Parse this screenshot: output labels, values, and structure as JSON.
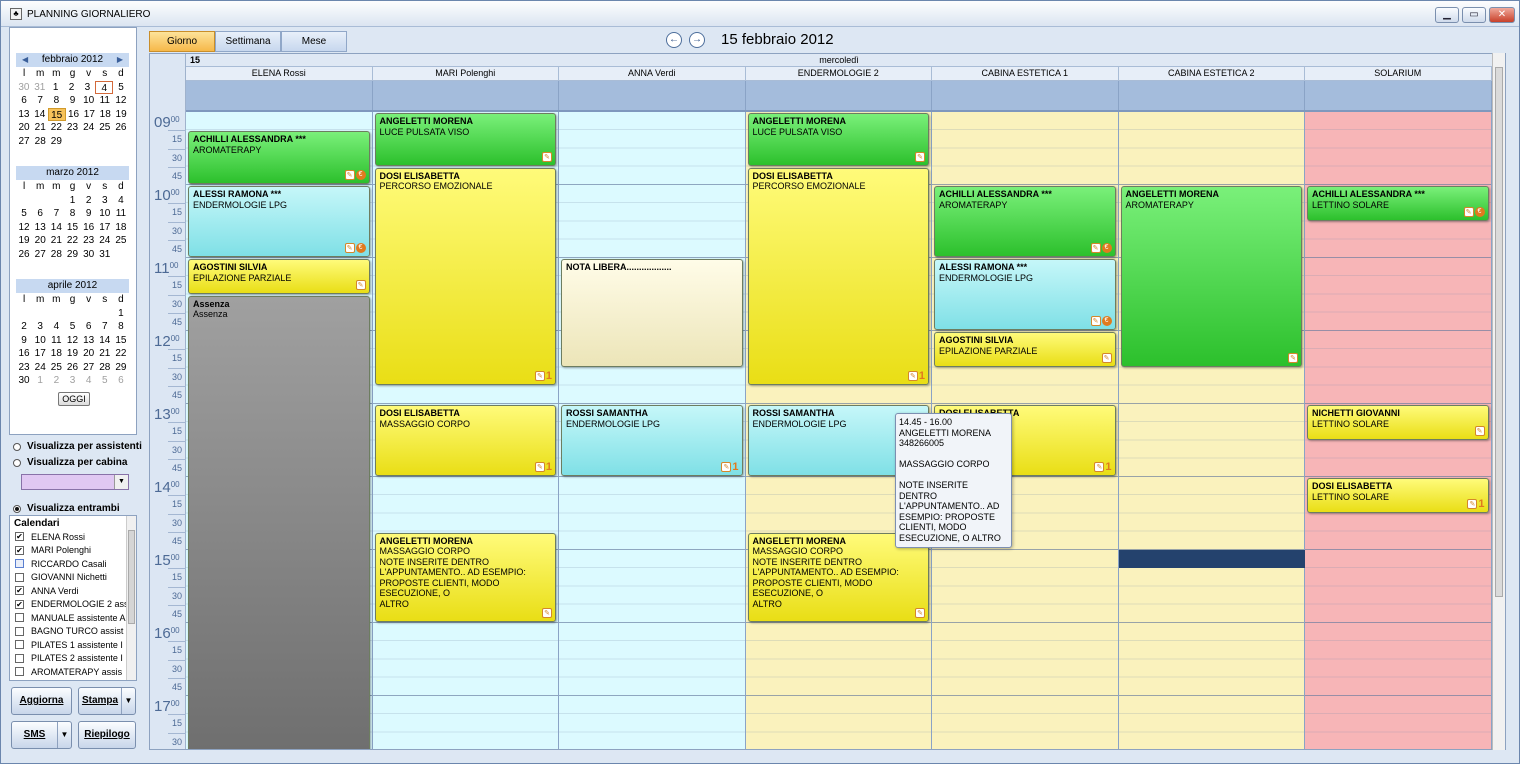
{
  "window": {
    "title": "PLANNING GIORNALIERO",
    "min": "▁",
    "max": "▭",
    "close": "✕"
  },
  "calendar": {
    "dow": [
      "l",
      "m",
      "m",
      "g",
      "v",
      "s",
      "d"
    ],
    "months": [
      {
        "label": "febbraio 2012",
        "weeks": [
          [
            "30",
            "31",
            "1",
            "2",
            "3",
            "4",
            "5"
          ],
          [
            "6",
            "7",
            "8",
            "9",
            "10",
            "11",
            "12"
          ],
          [
            "13",
            "14",
            "15",
            "16",
            "17",
            "18",
            "19"
          ],
          [
            "20",
            "21",
            "22",
            "23",
            "24",
            "25",
            "26"
          ],
          [
            "27",
            "28",
            "29",
            "",
            "",
            "",
            ""
          ]
        ]
      },
      {
        "label": "marzo 2012",
        "weeks": [
          [
            "",
            "",
            "",
            "1",
            "2",
            "3",
            "4"
          ],
          [
            "5",
            "6",
            "7",
            "8",
            "9",
            "10",
            "11"
          ],
          [
            "12",
            "13",
            "14",
            "15",
            "16",
            "17",
            "18"
          ],
          [
            "19",
            "20",
            "21",
            "22",
            "23",
            "24",
            "25"
          ],
          [
            "26",
            "27",
            "28",
            "29",
            "30",
            "31",
            ""
          ]
        ]
      },
      {
        "label": "aprile 2012",
        "weeks": [
          [
            "",
            "",
            "",
            "",
            "",
            "",
            "1"
          ],
          [
            "2",
            "3",
            "4",
            "5",
            "6",
            "7",
            "8"
          ],
          [
            "9",
            "10",
            "11",
            "12",
            "13",
            "14",
            "15"
          ],
          [
            "16",
            "17",
            "18",
            "19",
            "20",
            "21",
            "22"
          ],
          [
            "23",
            "24",
            "25",
            "26",
            "27",
            "28",
            "29"
          ],
          [
            "30",
            "1",
            "2",
            "3",
            "4",
            "5",
            "6"
          ]
        ]
      }
    ],
    "today_label": "OGGI"
  },
  "view_options": {
    "per_assistenti": "Visualizza per assistenti",
    "per_cabina": "Visualizza per cabina",
    "entrambi": "Visualizza entrambi"
  },
  "calendars": {
    "header": "Calendari",
    "items": [
      {
        "label": "ELENA Rossi",
        "checked": true
      },
      {
        "label": "MARI Polenghi",
        "checked": true
      },
      {
        "label": "RICCARDO Casali",
        "checked": false
      },
      {
        "label": "GIOVANNI Nichetti",
        "checked": false
      },
      {
        "label": "ANNA Verdi",
        "checked": true
      },
      {
        "label": "ENDERMOLOGIE 2 ass",
        "checked": true
      },
      {
        "label": "MANUALE assistente A",
        "checked": false
      },
      {
        "label": "BAGNO TURCO assist",
        "checked": false
      },
      {
        "label": "PILATES 1 assistente I",
        "checked": false
      },
      {
        "label": "PILATES 2 assistente I",
        "checked": false
      },
      {
        "label": "AROMATERAPY assis",
        "checked": false
      }
    ]
  },
  "buttons": {
    "aggiorna": "Aggiorna",
    "stampa": "Stampa",
    "sms": "SMS",
    "riepilogo": "Riepilogo",
    "dropdown": "▼"
  },
  "tabs": {
    "giorno": "Giorno",
    "settimana": "Settimana",
    "mese": "Mese"
  },
  "header": {
    "date": "15 febbraio 2012",
    "prev": "←",
    "next": "→",
    "day_number": "15",
    "day_name": "mercoledì"
  },
  "columns": [
    "ELENA Rossi",
    "MARI Polenghi",
    "ANNA Verdi",
    "ENDERMOLOGIE 2",
    "CABINA ESTETICA 1",
    "CABINA ESTETICA 2",
    "SOLARIUM"
  ],
  "hours": [
    "09",
    "10",
    "11",
    "12",
    "13",
    "14",
    "15",
    "16",
    "17"
  ],
  "quarters": [
    "15",
    "30",
    "45"
  ],
  "hour_suffix": "00",
  "tooltip": [
    "14.45 - 16.00",
    "ANGELETTI MORENA",
    "348266005",
    "",
    "MASSAGGIO CORPO",
    "",
    "NOTE INSERITE DENTRO",
    "L'APPUNTAMENTO.. AD",
    "ESEMPIO: PROPOSTE",
    "CLIENTI, MODO",
    "ESECUZIONE, O ALTRO"
  ],
  "icon_one": "1",
  "events": [
    {
      "col": 0,
      "start": 1,
      "end": 4,
      "style": "g",
      "title": "ACHILLI ALESSANDRA ***",
      "lines": [
        "AROMATERAPY"
      ],
      "icons": [
        "note",
        "euro"
      ]
    },
    {
      "col": 0,
      "start": 4,
      "end": 8,
      "style": "c",
      "title": "ALESSI RAMONA ***",
      "lines": [
        "ENDERMOLOGIE LPG"
      ],
      "icons": [
        "note",
        "euro"
      ]
    },
    {
      "col": 0,
      "start": 8,
      "end": 10,
      "style": "y",
      "title": "AGOSTINI SILVIA",
      "lines": [
        "EPILAZIONE PARZIALE"
      ],
      "icons": [
        "note"
      ]
    },
    {
      "col": 0,
      "start": 10,
      "end": 35.5,
      "style": "gr",
      "title": "Assenza",
      "lines": [
        "Assenza"
      ],
      "icons": []
    },
    {
      "col": 1,
      "start": 0,
      "end": 3,
      "style": "g",
      "title": "ANGELETTI MORENA",
      "lines": [
        "LUCE PULSATA VISO"
      ],
      "icons": [
        "note"
      ]
    },
    {
      "col": 1,
      "start": 3,
      "end": 15,
      "style": "y",
      "title": "DOSI ELISABETTA",
      "lines": [
        "PERCORSO EMOZIONALE"
      ],
      "icons": [
        "note",
        "one"
      ]
    },
    {
      "col": 1,
      "start": 16,
      "end": 20,
      "style": "y",
      "title": "DOSI ELISABETTA",
      "lines": [
        "MASSAGGIO CORPO"
      ],
      "icons": [
        "note",
        "one"
      ]
    },
    {
      "col": 1,
      "start": 23,
      "end": 28,
      "style": "y",
      "title": "ANGELETTI MORENA",
      "lines": [
        "MASSAGGIO CORPO",
        "NOTE INSERITE DENTRO",
        "L'APPUNTAMENTO.. AD ESEMPIO:",
        "PROPOSTE CLIENTI, MODO ESECUZIONE, O",
        "ALTRO"
      ],
      "icons": [
        "note"
      ]
    },
    {
      "col": 2,
      "start": 8,
      "end": 14,
      "style": "p",
      "title": "NOTA LIBERA..................",
      "lines": [],
      "icons": []
    },
    {
      "col": 2,
      "start": 16,
      "end": 20,
      "style": "c",
      "title": "ROSSI SAMANTHA",
      "lines": [
        "ENDERMOLOGIE LPG"
      ],
      "icons": [
        "note",
        "one"
      ]
    },
    {
      "col": 3,
      "start": 0,
      "end": 3,
      "style": "g",
      "title": "ANGELETTI MORENA",
      "lines": [
        "LUCE PULSATA VISO"
      ],
      "icons": [
        "note"
      ]
    },
    {
      "col": 3,
      "start": 3,
      "end": 15,
      "style": "y",
      "title": "DOSI ELISABETTA",
      "lines": [
        "PERCORSO EMOZIONALE"
      ],
      "icons": [
        "note",
        "one"
      ]
    },
    {
      "col": 3,
      "start": 16,
      "end": 20,
      "style": "c",
      "title": "ROSSI SAMANTHA",
      "lines": [
        "ENDERMOLOGIE LPG"
      ],
      "icons": []
    },
    {
      "col": 3,
      "start": 23,
      "end": 28,
      "style": "y",
      "title": "ANGELETTI MORENA",
      "lines": [
        "MASSAGGIO CORPO",
        "NOTE INSERITE DENTRO",
        "L'APPUNTAMENTO.. AD ESEMPIO:",
        "PROPOSTE CLIENTI, MODO ESECUZIONE, O",
        "ALTRO"
      ],
      "icons": [
        "note"
      ]
    },
    {
      "col": 4,
      "start": 4,
      "end": 8,
      "style": "g",
      "title": "ACHILLI ALESSANDRA ***",
      "lines": [
        "AROMATERAPY"
      ],
      "icons": [
        "note",
        "euro"
      ]
    },
    {
      "col": 4,
      "start": 8,
      "end": 12,
      "style": "c",
      "title": "ALESSI RAMONA ***",
      "lines": [
        "ENDERMOLOGIE LPG"
      ],
      "icons": [
        "note",
        "euro"
      ]
    },
    {
      "col": 4,
      "start": 12,
      "end": 14,
      "style": "y",
      "title": "AGOSTINI SILVIA",
      "lines": [
        "EPILAZIONE PARZIALE"
      ],
      "icons": [
        "note"
      ]
    },
    {
      "col": 4,
      "start": 16,
      "end": 20,
      "style": "y",
      "title": "DOSI ELISABETTA",
      "lines": [
        "O"
      ],
      "icons": [
        "note",
        "one"
      ]
    },
    {
      "col": 5,
      "start": 4,
      "end": 14,
      "style": "g",
      "title": "ANGELETTI MORENA",
      "lines": [
        "AROMATERAPY"
      ],
      "icons": [
        "note"
      ]
    },
    {
      "col": 6,
      "start": 4,
      "end": 6,
      "style": "g",
      "title": "ACHILLI ALESSANDRA ***",
      "lines": [
        "LETTINO SOLARE"
      ],
      "icons": [
        "note",
        "euro"
      ]
    },
    {
      "col": 6,
      "start": 16,
      "end": 18,
      "style": "y",
      "title": "NICHETTI GIOVANNI",
      "lines": [
        "LETTINO SOLARE"
      ],
      "icons": [
        "note"
      ]
    },
    {
      "col": 6,
      "start": 20,
      "end": 22,
      "style": "y",
      "title": "DOSI ELISABETTA",
      "lines": [
        "LETTINO SOLARE"
      ],
      "icons": [
        "note",
        "one"
      ]
    }
  ],
  "colors": {
    "col_bg": [
      "#dcfaff",
      "#dcfaff",
      "#dcfaff",
      "#faf2bd",
      "#faf2bd",
      "#faf2bd",
      "#f7b5b7"
    ],
    "selection": "#24426d"
  },
  "selection_slot": {
    "col": 5,
    "slot": 24
  }
}
